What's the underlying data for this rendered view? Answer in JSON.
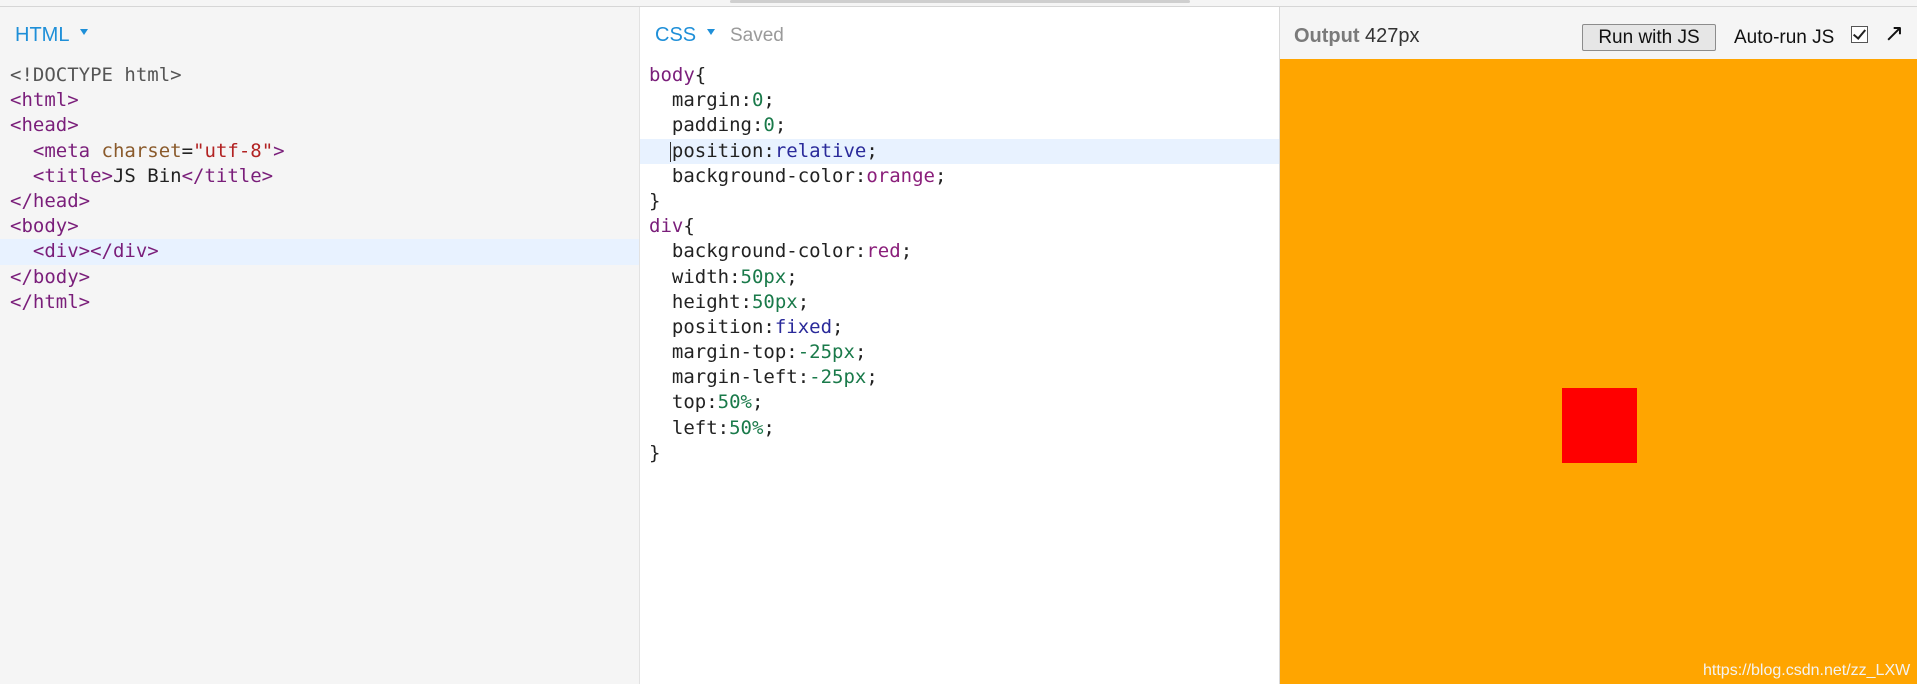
{
  "html_panel": {
    "label": "HTML",
    "code": [
      [
        [
          "t-meta",
          "<!DOCTYPE html>"
        ]
      ],
      [
        [
          "t-tag",
          "<html>"
        ]
      ],
      [
        [
          "t-tag",
          "<head>"
        ]
      ],
      [
        [
          "t-text",
          "  "
        ],
        [
          "t-tag",
          "<meta "
        ],
        [
          "t-attr",
          "charset"
        ],
        [
          "t-punc",
          "="
        ],
        [
          "t-str",
          "\"utf-8\""
        ],
        [
          "t-tag",
          ">"
        ]
      ],
      [
        [
          "t-text",
          "  "
        ],
        [
          "t-tag",
          "<title>"
        ],
        [
          "t-text",
          "JS Bin"
        ],
        [
          "t-tag",
          "</title>"
        ]
      ],
      [
        [
          "t-tag",
          "</head>"
        ]
      ],
      [
        [
          "t-tag",
          "<body>"
        ]
      ],
      [
        [
          "t-text",
          "  "
        ],
        [
          "t-tag",
          "<div></div>"
        ]
      ],
      [
        [
          "t-tag",
          "</body>"
        ]
      ],
      [
        [
          "t-tag",
          "</html>"
        ]
      ]
    ],
    "active_line": 7
  },
  "css_panel": {
    "label": "CSS",
    "status": "Saved",
    "code": [
      [
        [
          "t-sel",
          "body"
        ],
        [
          "t-punc",
          "{"
        ]
      ],
      [
        [
          "t-prop",
          "  margin"
        ],
        [
          "t-punc",
          ":"
        ],
        [
          "t-num",
          "0"
        ],
        [
          "t-punc",
          ";"
        ]
      ],
      [
        [
          "t-prop",
          "  padding"
        ],
        [
          "t-punc",
          ":"
        ],
        [
          "t-num",
          "0"
        ],
        [
          "t-punc",
          ";"
        ]
      ],
      [
        [
          "t-prop",
          "  position"
        ],
        [
          "t-punc",
          ":"
        ],
        [
          "t-kw",
          "relative"
        ],
        [
          "t-punc",
          ";"
        ]
      ],
      [
        [
          "t-prop",
          "  background-color"
        ],
        [
          "t-punc",
          ":"
        ],
        [
          "t-col",
          "orange"
        ],
        [
          "t-punc",
          ";"
        ]
      ],
      [
        [
          "t-punc",
          "}"
        ]
      ],
      [
        [
          "t-sel",
          "div"
        ],
        [
          "t-punc",
          "{"
        ]
      ],
      [
        [
          "t-prop",
          "  background-color"
        ],
        [
          "t-punc",
          ":"
        ],
        [
          "t-col",
          "red"
        ],
        [
          "t-punc",
          ";"
        ]
      ],
      [
        [
          "t-prop",
          "  width"
        ],
        [
          "t-punc",
          ":"
        ],
        [
          "t-num",
          "50px"
        ],
        [
          "t-punc",
          ";"
        ]
      ],
      [
        [
          "t-prop",
          "  height"
        ],
        [
          "t-punc",
          ":"
        ],
        [
          "t-num",
          "50px"
        ],
        [
          "t-punc",
          ";"
        ]
      ],
      [
        [
          "t-prop",
          "  position"
        ],
        [
          "t-punc",
          ":"
        ],
        [
          "t-kw",
          "fixed"
        ],
        [
          "t-punc",
          ";"
        ]
      ],
      [
        [
          "t-prop",
          "  margin-top"
        ],
        [
          "t-punc",
          ":"
        ],
        [
          "t-num",
          "-25px"
        ],
        [
          "t-punc",
          ";"
        ]
      ],
      [
        [
          "t-prop",
          "  margin-left"
        ],
        [
          "t-punc",
          ":"
        ],
        [
          "t-num",
          "-25px"
        ],
        [
          "t-punc",
          ";"
        ]
      ],
      [
        [
          "t-prop",
          "  top"
        ],
        [
          "t-punc",
          ":"
        ],
        [
          "t-num",
          "50%"
        ],
        [
          "t-punc",
          ";"
        ]
      ],
      [
        [
          "t-prop",
          "  left"
        ],
        [
          "t-punc",
          ":"
        ],
        [
          "t-num",
          "50%"
        ],
        [
          "t-punc",
          ";"
        ]
      ],
      [
        [
          "t-punc",
          "}"
        ]
      ]
    ],
    "active_line": 3
  },
  "output_panel": {
    "label": "Output",
    "width_text": "427px",
    "run_button": "Run with JS",
    "autorun_label": "Auto-run JS",
    "autorun_checked": true,
    "preview_bg": "#ffa500",
    "box_color": "#ff0000",
    "watermark": "https://blog.csdn.net/zz_LXW"
  }
}
